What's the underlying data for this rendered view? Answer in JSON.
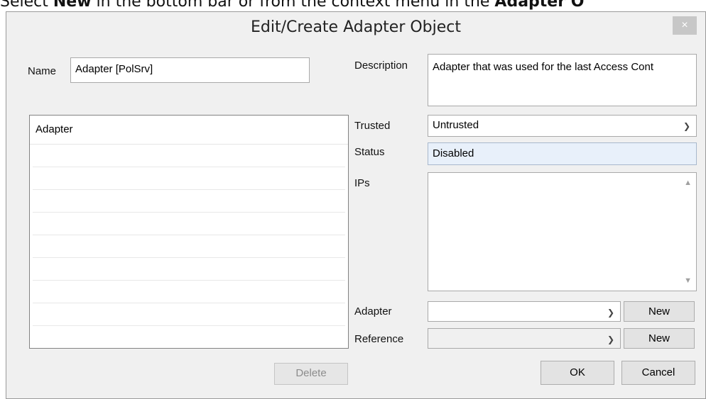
{
  "instruction": {
    "prefix": "Select ",
    "bold1": "New",
    "middle": " in the bottom bar or from the context menu in the ",
    "bold2": "Adapter O"
  },
  "dialog": {
    "title": "Edit/Create Adapter Object",
    "close_glyph": "×",
    "name_label": "Name",
    "name_value": "Adapter [PolSrv]",
    "description_label": "Description",
    "description_value": "Adapter that was used for the last Access Cont",
    "list_header": "Adapter",
    "delete_label": "Delete",
    "trusted_label": "Trusted",
    "trusted_value": "Untrusted",
    "status_label": "Status",
    "status_value": "Disabled",
    "ips_label": "IPs",
    "adapter_label": "Adapter",
    "adapter_value": "",
    "adapter_new": "New",
    "reference_label": "Reference",
    "reference_value": "",
    "reference_new": "New",
    "ok_label": "OK",
    "cancel_label": "Cancel"
  },
  "icons": {
    "chevron": "chevron-down-icon",
    "close": "close-icon",
    "scroll_up": "scroll-up-icon",
    "scroll_down": "scroll-down-icon"
  }
}
